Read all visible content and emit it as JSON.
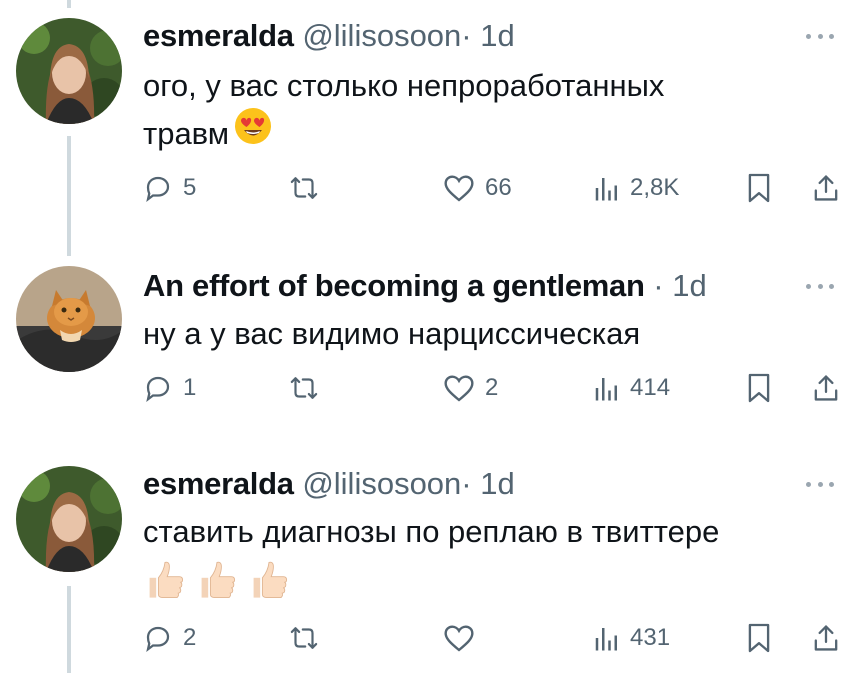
{
  "colors": {
    "text": "#0f1419",
    "muted": "#536471",
    "thread_line": "#cfd9de"
  },
  "tweets": [
    {
      "display_name": "esmeralda",
      "handle": "@lilisosoon",
      "separator": "·",
      "time": "1d",
      "text_lines": [
        "ого, у вас столько непроработанных",
        "травм"
      ],
      "emoji": [
        "smiling-face-with-heart-eyes"
      ],
      "replies": "5",
      "retweets": "",
      "likes": "66",
      "views": "2,8K"
    },
    {
      "display_name": "An effort of becoming a gentleman",
      "handle": "",
      "separator": "·",
      "time": "1d",
      "text_lines": [
        "ну а у вас видимо нарциссическая"
      ],
      "emoji": [],
      "replies": "1",
      "retweets": "",
      "likes": "2",
      "views": "414"
    },
    {
      "display_name": "esmeralda",
      "handle": "@lilisosoon",
      "separator": "·",
      "time": "1d",
      "text_lines": [
        "ставить диагнозы по реплаю в твиттере"
      ],
      "emoji": [
        "thumbs-up",
        "thumbs-up",
        "thumbs-up"
      ],
      "replies": "2",
      "retweets": "",
      "likes": "",
      "views": "431"
    }
  ]
}
